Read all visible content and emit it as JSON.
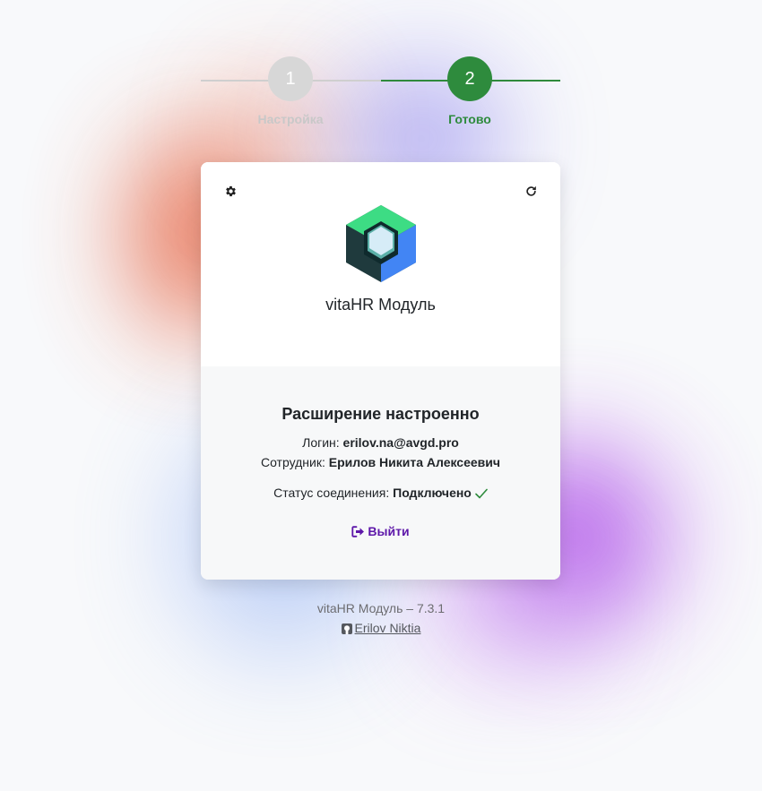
{
  "stepper": {
    "steps": [
      {
        "number": "1",
        "label": "Настройка",
        "state": "inactive"
      },
      {
        "number": "2",
        "label": "Готово",
        "state": "active"
      }
    ],
    "active_color": "#2e8b3d",
    "inactive_color": "#d7d7d7"
  },
  "card": {
    "settings_icon": "gear-icon",
    "refresh_icon": "refresh-icon",
    "app_title": "vitaHR Модуль",
    "status_title": "Расширение настроенно",
    "login_label": "Логин:",
    "login_value": "erilov.na@avgd.pro",
    "employee_label": "Сотрудник:",
    "employee_value": "Ерилов Никита Алексеевич",
    "connection_label": "Статус соединения:",
    "connection_value": "Подключено",
    "logout_label": "Выйти",
    "accent_color": "#5d17a9"
  },
  "footer": {
    "version_text": "vitaHR Модуль – 7.3.1",
    "author_link": "Erilov Niktia"
  }
}
